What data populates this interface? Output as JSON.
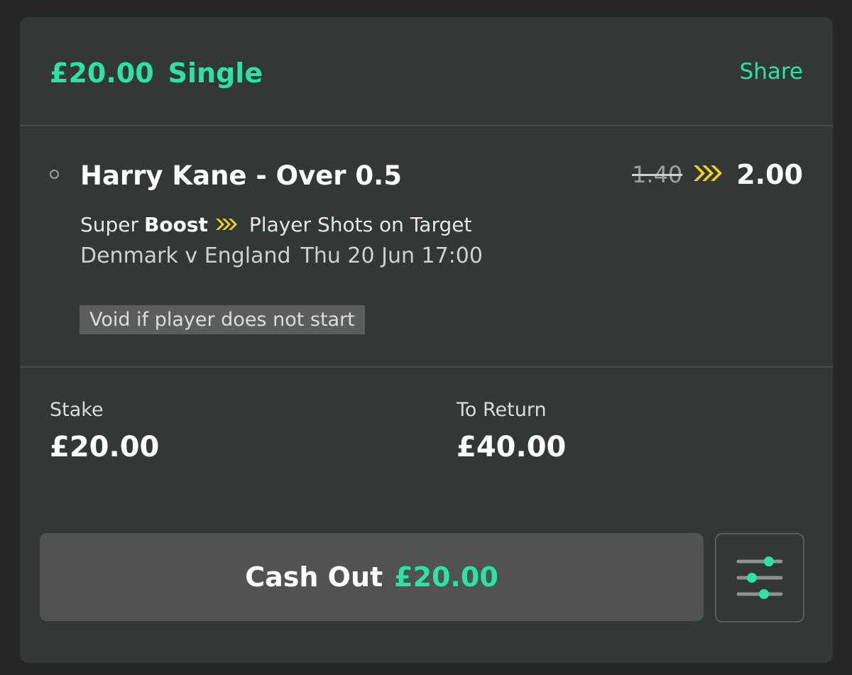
{
  "bet": {
    "stake_amount": "£20.00",
    "bet_type": "Single",
    "share_label": "Share"
  },
  "selection": {
    "name": "Harry Kane - Over 0.5",
    "old_odds": "1.40",
    "new_odds": "2.00",
    "promo_prefix": "Super",
    "promo_bold": "Boost",
    "market": "Player Shots on Target",
    "event": "Denmark v England",
    "datetime": "Thu 20 Jun 17:00",
    "void_note": "Void if player does not start"
  },
  "totals": {
    "stake_label": "Stake",
    "stake_value": "£20.00",
    "return_label": "To Return",
    "return_value": "£40.00"
  },
  "cash_out": {
    "label": "Cash Out",
    "amount": "£20.00"
  },
  "colors": {
    "accent": "#2ce3a4",
    "boost_chevron": "#f6d31b",
    "card_bg": "#333735",
    "page_bg": "#262827"
  },
  "icons": {
    "boost": "triple-chevron-right-icon",
    "settings": "sliders-icon"
  }
}
